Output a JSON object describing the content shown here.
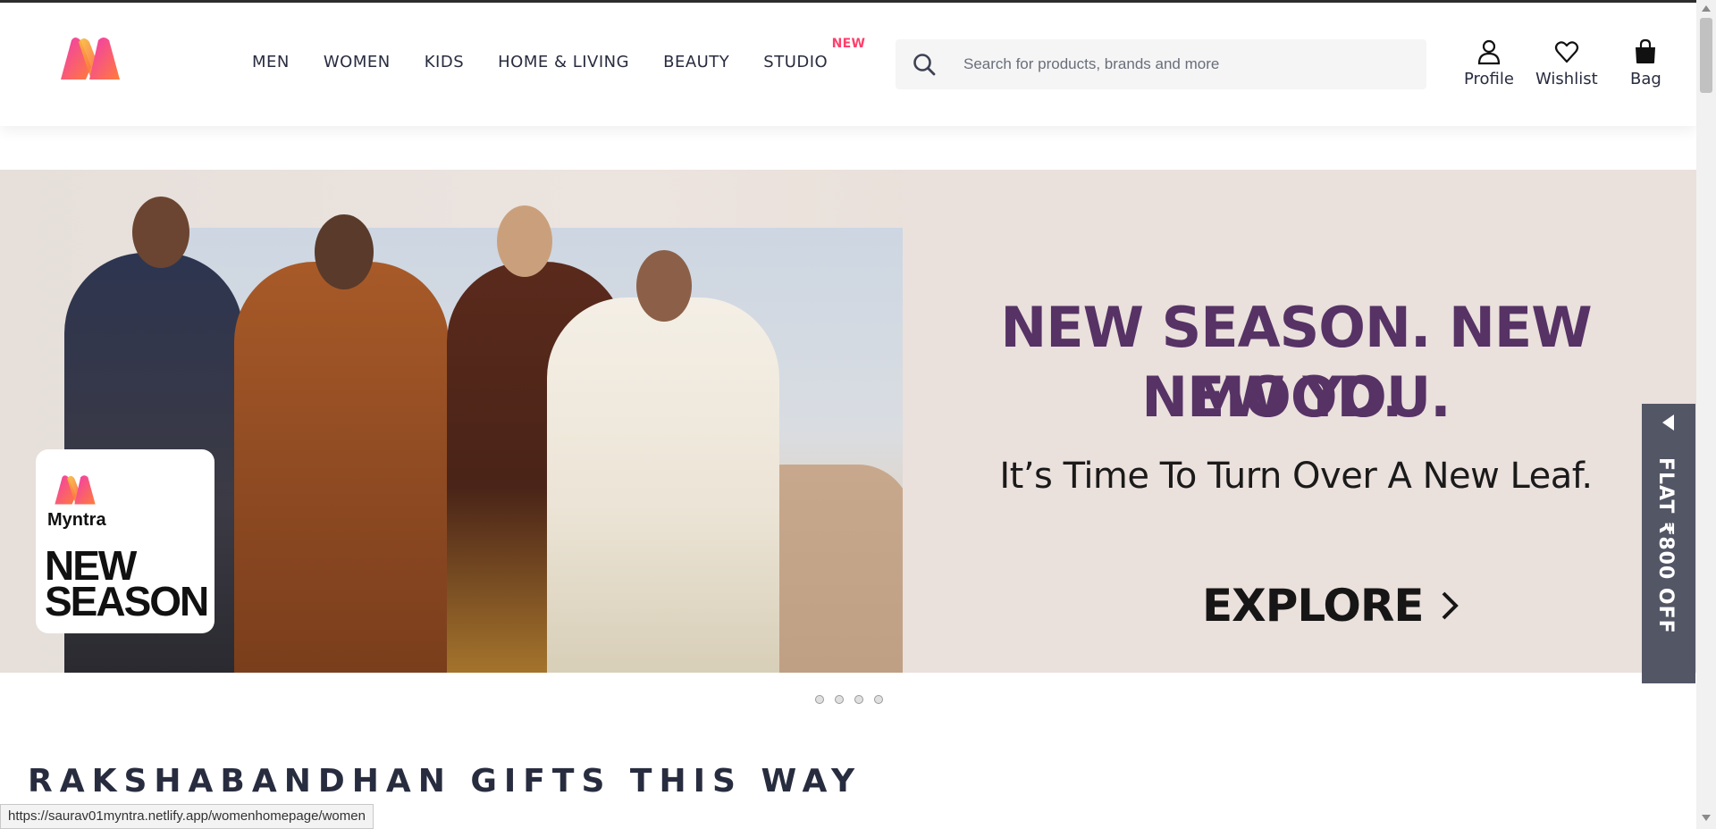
{
  "header": {
    "logo_alt": "Myntra",
    "nav": [
      {
        "label": "MEN"
      },
      {
        "label": "WOMEN"
      },
      {
        "label": "KIDS"
      },
      {
        "label": "HOME & LIVING"
      },
      {
        "label": "BEAUTY"
      },
      {
        "label": "STUDIO",
        "badge": "NEW"
      }
    ],
    "search": {
      "placeholder": "Search for products, brands and more",
      "icon": "search-icon"
    },
    "actions": [
      {
        "label": "Profile",
        "icon": "profile-icon"
      },
      {
        "label": "Wishlist",
        "icon": "heart-icon"
      },
      {
        "label": "Bag",
        "icon": "bag-icon"
      }
    ]
  },
  "hero": {
    "headline_line1": "NEW SEASON. NEW MOOD.",
    "headline_line2": "NEW YOU.",
    "subheadline": "It’s Time To Turn Over A New Leaf.",
    "cta": "EXPLORE",
    "badge": {
      "brand": "Myntra",
      "line1": "NEW",
      "line2": "SEASON"
    },
    "slide_count": 4
  },
  "offer_tab": {
    "text": "FLAT ₹800 OFF"
  },
  "section": {
    "title": "RAKSHABANDHAN GIFTS THIS WAY"
  },
  "status_bar": {
    "url": "https://saurav01myntra.netlify.app/womenhomepage/women"
  },
  "colors": {
    "brand_pink": "#ff3f6c",
    "headline_purple": "#563265",
    "text_dark": "#282c3f",
    "tab_grey": "#535665"
  }
}
